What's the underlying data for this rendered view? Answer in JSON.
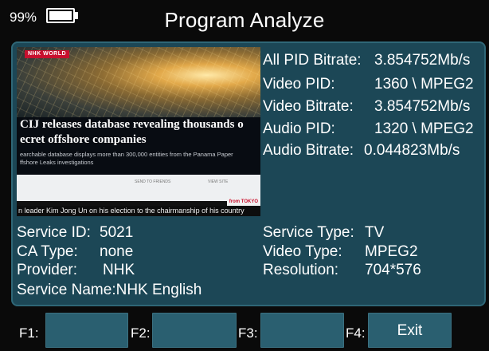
{
  "status": {
    "battery_text": "99%",
    "battery_level": 0.99
  },
  "header": {
    "title": "Program Analyze"
  },
  "preview": {
    "logo": "NHK WORLD",
    "headline_line1": "CIJ releases database revealing thousands o",
    "headline_line2": "ecret offshore companies",
    "subtext_line1": "earchable database displays more than 300,000 entities from the Panama Paper",
    "subtext_line2": "ffshore Leaks investigations",
    "button_1": "SEND TO FRIENDS",
    "button_2": "VIEW SITE",
    "ticker_label": "from TOKYO",
    "ticker_text": "n leader Kim Jong Un on his election to the chairmanship of his country"
  },
  "stream": {
    "all_pid_bitrate_label": "All PID Bitrate:",
    "all_pid_bitrate_value": "3.854752Mb/s",
    "video_pid_label": "Video PID:",
    "video_pid_value": "1360 \\ MPEG2",
    "video_bitrate_label": "Video Bitrate:",
    "video_bitrate_value": "3.854752Mb/s",
    "audio_pid_label": "Audio PID:",
    "audio_pid_value": "1320 \\ MPEG2",
    "audio_bitrate_label": "Audio Bitrate:",
    "audio_bitrate_value": "0.044823Mb/s"
  },
  "service": {
    "service_id_label": "Service ID:",
    "service_id_value": "5021",
    "ca_type_label": "CA Type:",
    "ca_type_value": "none",
    "provider_label": "Provider:",
    "provider_value": "NHK",
    "service_name_label": "Service Name:",
    "service_name_value": "NHK English",
    "service_type_label": "Service Type:",
    "service_type_value": "TV",
    "video_type_label": "Video Type:",
    "video_type_value": "MPEG2",
    "resolution_label": "Resolution:",
    "resolution_value": "704*576"
  },
  "footer": {
    "f1_label": "F1:",
    "f1_button": "",
    "f2_label": "F2:",
    "f2_button": "",
    "f3_label": "F3:",
    "f3_button": "",
    "f4_label": "F4:",
    "f4_button": "Exit"
  },
  "colors": {
    "panel": "#1c4756",
    "panel_border": "#2f6777",
    "button": "#2a5f70",
    "background": "#0a0a0a"
  }
}
